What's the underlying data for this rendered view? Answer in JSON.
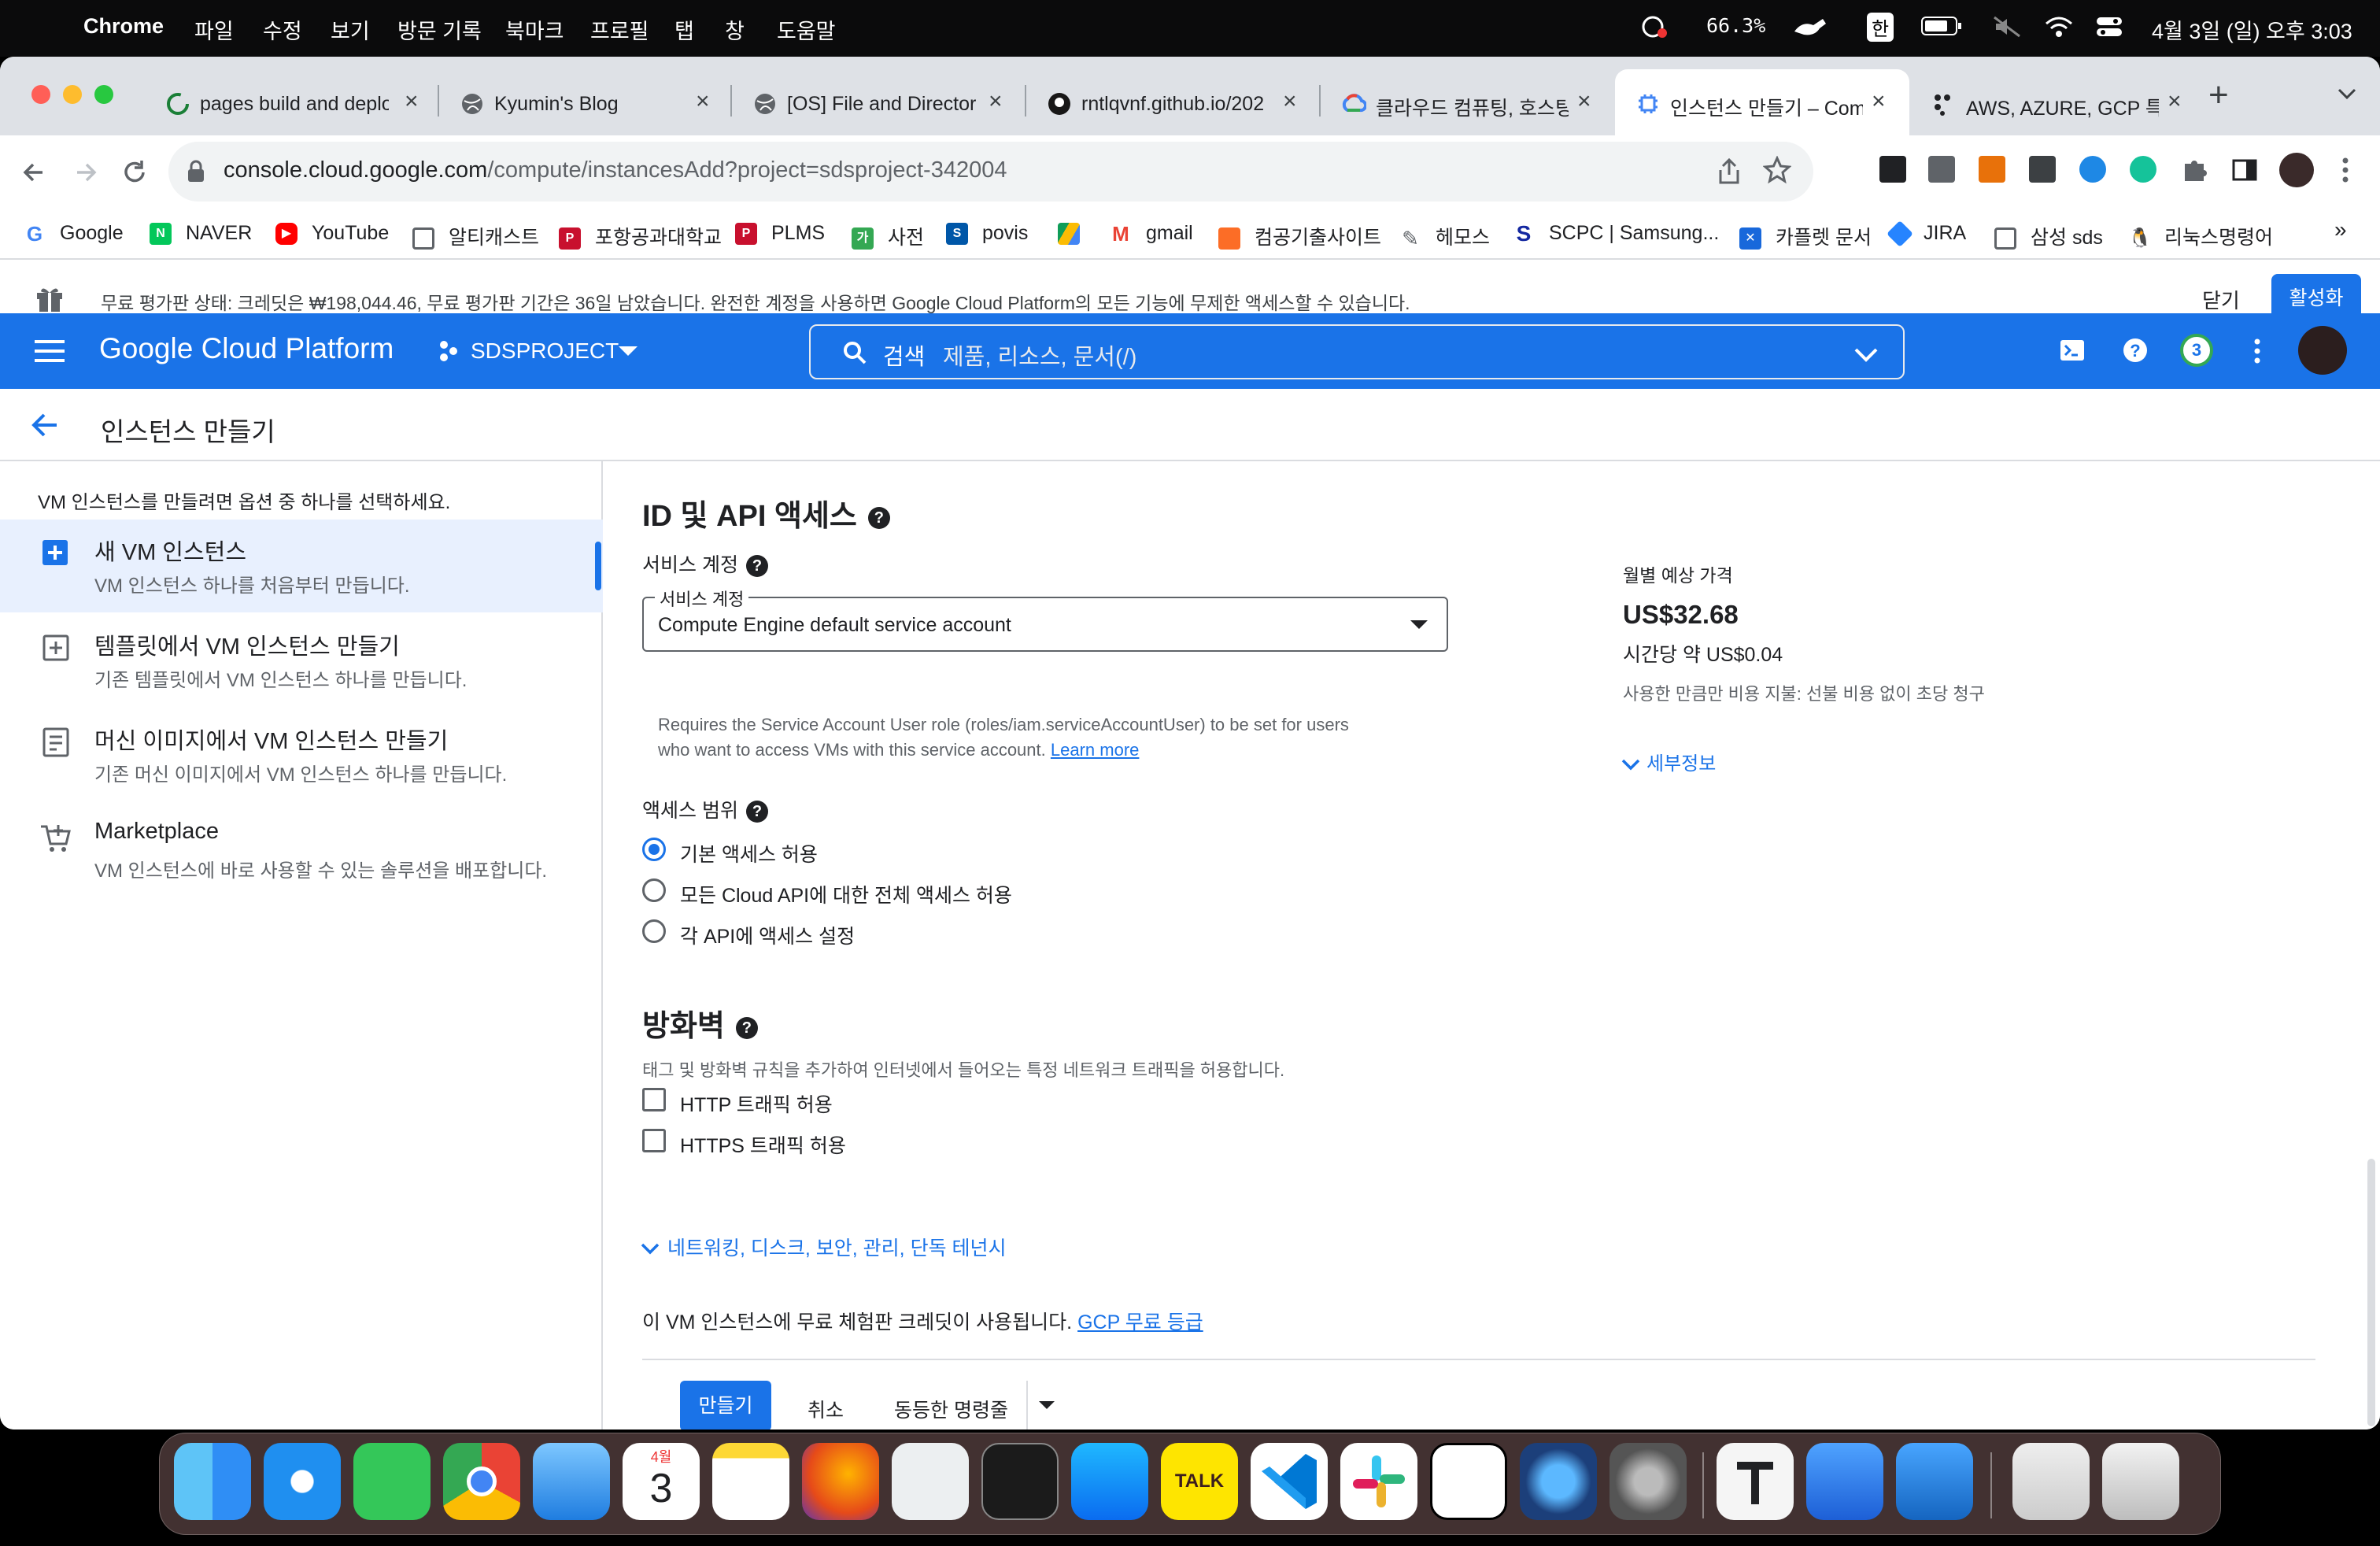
{
  "menubar": {
    "app": "Chrome",
    "items": [
      "파일",
      "수정",
      "보기",
      "방문 기록",
      "북마크",
      "프로필",
      "탭",
      "창",
      "도움말"
    ],
    "battery_pct": "66.3%",
    "ime": "한",
    "datetime": "4월 3일 (일) 오후 3:03"
  },
  "tabs": [
    {
      "title": "pages build and deplo"
    },
    {
      "title": "Kyumin's Blog"
    },
    {
      "title": "[OS] File and Director"
    },
    {
      "title": "rntlqvnf.github.io/202"
    },
    {
      "title": "클라우드 컴퓨팅, 호스팅"
    },
    {
      "title": "인스턴스 만들기 – Comp"
    },
    {
      "title": "AWS, AZURE, GCP 특"
    }
  ],
  "tab_close": "×",
  "new_tab": "+",
  "url": "console.cloud.google.com/compute/instancesAdd?project=sdsproject-342004",
  "url_host": "console.cloud.google.com",
  "url_path": "/compute/instancesAdd?project=sdsproject-342004",
  "bookmarks": [
    "Google",
    "NAVER",
    "YouTube",
    "알티캐스트",
    "포항공과대학교",
    "PLMS",
    "사전",
    "povis",
    "gmail",
    "컴공기출사이트",
    "헤모스",
    "SCPC | Samsung...",
    "카플렛 문서",
    "JIRA",
    "삼성 sds",
    "리눅스명령어"
  ],
  "bookmarks_more": "»",
  "trial": {
    "text": "무료 평가판 상태: 크레딧은 ₩198,044.46, 무료 평가판 기간은 36일 남았습니다. 완전한 계정을 사용하면 Google Cloud Platform의 모든 기능에 무제한 액세스할 수 있습니다.",
    "close": "닫기",
    "activate": "활성화"
  },
  "gcp": {
    "brand": "Google Cloud Platform",
    "project": "SDSPROJECT",
    "search_label": "검색",
    "search_placeholder": "제품, 리소스, 문서(/)",
    "notif_count": "3"
  },
  "page_title": "인스턴스 만들기",
  "leftnav": {
    "intro": "VM 인스턴스를 만들려면 옵션 중 하나를 선택하세요.",
    "items": [
      {
        "title": "새 VM 인스턴스",
        "desc": "VM 인스턴스 하나를 처음부터 만듭니다.",
        "icon": "add-box-icon"
      },
      {
        "title": "템플릿에서 VM 인스턴스 만들기",
        "desc": "기존 템플릿에서 VM 인스턴스 하나를 만듭니다.",
        "icon": "template-icon"
      },
      {
        "title": "머신 이미지에서 VM 인스턴스 만들기",
        "desc": "기존 머신 이미지에서 VM 인스턴스 하나를 만듭니다.",
        "icon": "machine-image-icon"
      },
      {
        "title": "Marketplace",
        "desc": "VM 인스턴스에 바로 사용할 수 있는 솔루션을 배포합니다.",
        "icon": "cart-icon"
      }
    ]
  },
  "identity": {
    "heading": "ID 및 API 액세스",
    "sa_label": "서비스 계정",
    "sa_float": "서비스 계정",
    "sa_value": "Compute Engine default service account",
    "sa_hint_1": "Requires the Service Account User role (roles/iam.serviceAccountUser) to be set for users",
    "sa_hint_2": "who want to access VMs with this service account.",
    "learn_more": "Learn more",
    "scope_label": "액세스 범위",
    "scopes": [
      "기본 액세스 허용",
      "모든 Cloud API에 대한 전체 액세스 허용",
      "각 API에 액세스 설정"
    ],
    "scope_selected": 0
  },
  "firewall": {
    "heading": "방화벽",
    "desc": "태그 및 방화벽 규칙을 추가하여 인터넷에서 들어오는 특정 네트워크 트래픽을 허용합니다.",
    "http": "HTTP 트래픽 허용",
    "https": "HTTPS 트래픽 허용",
    "http_checked": false,
    "https_checked": false
  },
  "advanced": "네트워킹, 디스크, 보안, 관리, 단독 테넌시",
  "credit_note": "이 VM 인스턴스에 무료 체험판 크레딧이 사용됩니다.",
  "credit_link": "GCP 무료 등급",
  "actions": {
    "create": "만들기",
    "cancel": "취소",
    "equivalent": "동등한 명령줄"
  },
  "pricing": {
    "label": "월별 예상 가격",
    "monthly": "US$32.68",
    "hourly": "시간당 약 US$0.04",
    "note": "사용한 만큼만 비용 지불: 선불 비용 없이 초당 청구",
    "details": "세부정보"
  },
  "dock": {
    "calendar_month": "4월",
    "calendar_day": "3",
    "talk": "TALK"
  },
  "colors": {
    "gcp_blue": "#1a73e8",
    "link": "#1a73e8",
    "text": "#202124",
    "muted": "#5f6368"
  }
}
